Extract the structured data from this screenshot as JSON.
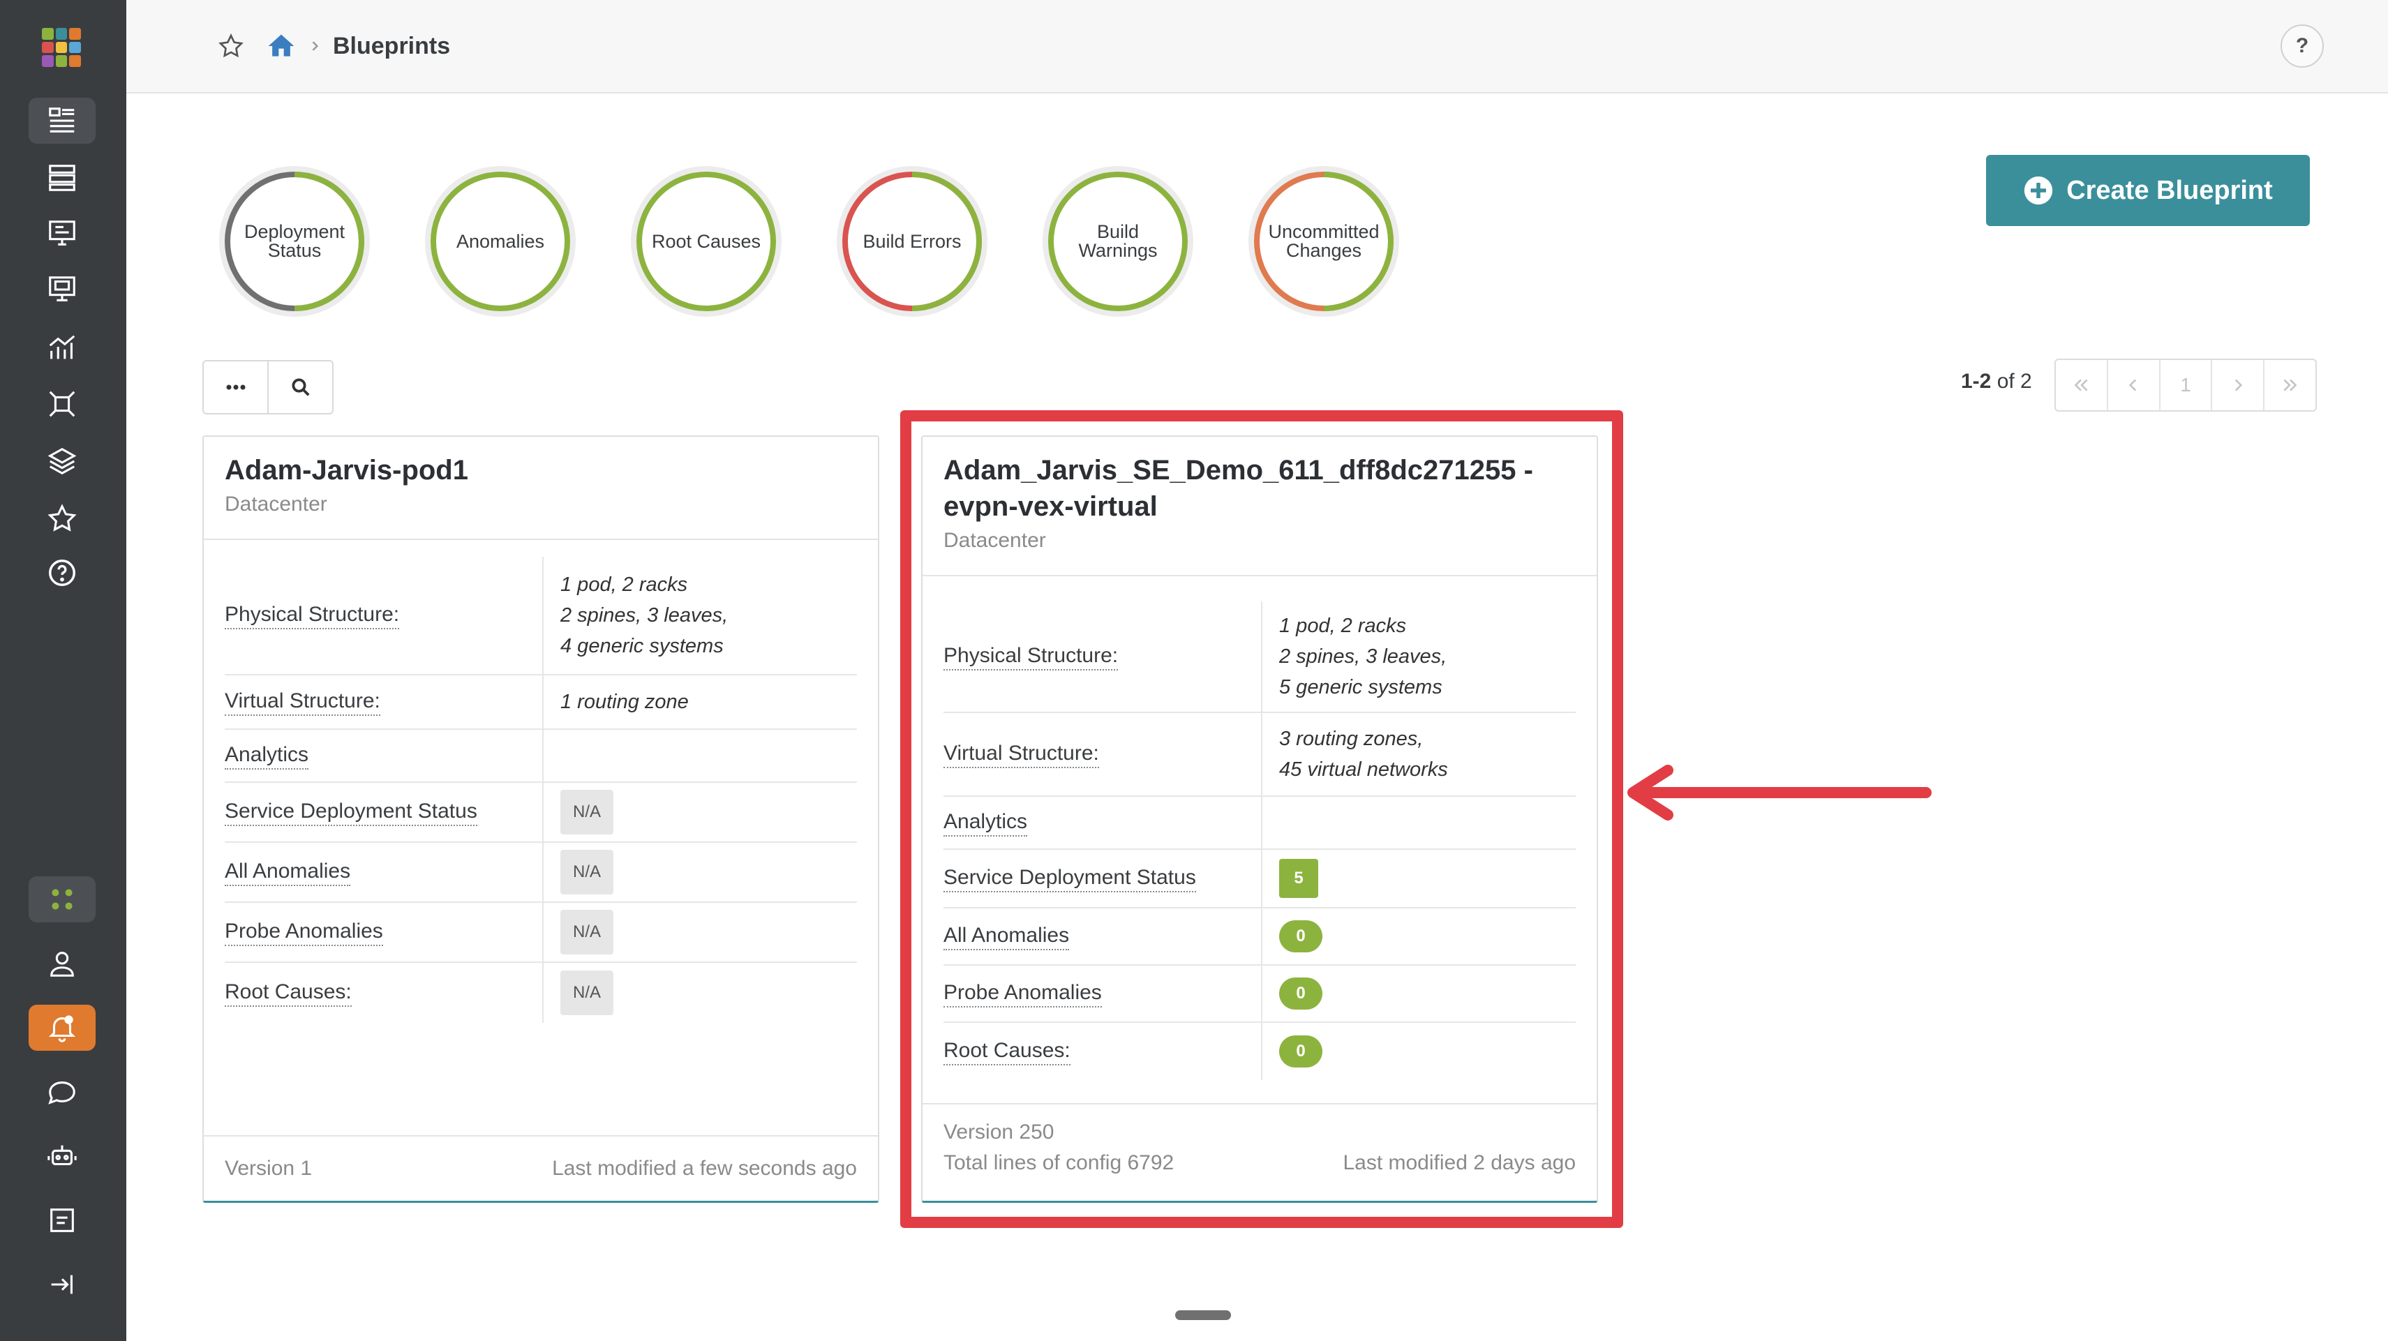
{
  "breadcrumb": {
    "title": "Blueprints"
  },
  "help": {
    "label": "?"
  },
  "status_rings": [
    {
      "label": "Deployment Status",
      "colors": [
        "#8db33f",
        "#707070"
      ]
    },
    {
      "label": "Anomalies",
      "colors": [
        "#8db33f"
      ]
    },
    {
      "label": "Root Causes",
      "colors": [
        "#8db33f"
      ]
    },
    {
      "label": "Build Errors",
      "colors": [
        "#8db33f",
        "#d9534f"
      ]
    },
    {
      "label": "Build Warnings",
      "colors": [
        "#8db33f"
      ]
    },
    {
      "label": "Uncommitted Changes",
      "colors": [
        "#8db33f",
        "#e07a4f"
      ]
    }
  ],
  "create_button": {
    "label": "Create Blueprint"
  },
  "pagination": {
    "range": "1-2",
    "of_text": "of 2",
    "page": "1"
  },
  "cards": [
    {
      "title": "Adam-Jarvis-pod1",
      "type": "Datacenter",
      "rows": {
        "physical_label": "Physical Structure:",
        "physical_lines": [
          "1 pod, 2 racks",
          "2 spines, 3 leaves,",
          "4 generic systems"
        ],
        "virtual_label": "Virtual Structure:",
        "virtual_lines": [
          "1 routing zone"
        ],
        "analytics_label": "Analytics",
        "service_label": "Service Deployment Status",
        "service_value": "N/A",
        "all_anomalies_label": "All Anomalies",
        "all_anomalies_value": "N/A",
        "probe_label": "Probe Anomalies",
        "probe_value": "N/A",
        "root_label": "Root Causes:",
        "root_value": "N/A"
      },
      "version": "Version 1",
      "config_lines": "",
      "modified": "Last modified a few seconds ago"
    },
    {
      "title": "Adam_Jarvis_SE_Demo_611_dff8dc271255 - evpn-vex-virtual",
      "type": "Datacenter",
      "rows": {
        "physical_label": "Physical Structure:",
        "physical_lines": [
          "1 pod, 2 racks",
          "2 spines, 3 leaves,",
          "5 generic systems"
        ],
        "virtual_label": "Virtual Structure:",
        "virtual_lines": [
          "3 routing zones,",
          "45 virtual networks"
        ],
        "analytics_label": "Analytics",
        "service_label": "Service Deployment Status",
        "service_value": "5",
        "all_anomalies_label": "All Anomalies",
        "all_anomalies_value": "0",
        "probe_label": "Probe Anomalies",
        "probe_value": "0",
        "root_label": "Root Causes:",
        "root_value": "0"
      },
      "version": "Version 250",
      "config_lines": "Total lines of config 6792",
      "modified": "Last modified 2 days ago"
    }
  ],
  "colors": {
    "accent": "#3a8f9b",
    "highlight": "#e23d45",
    "ok": "#8db33f",
    "alert": "#e07a2e"
  }
}
